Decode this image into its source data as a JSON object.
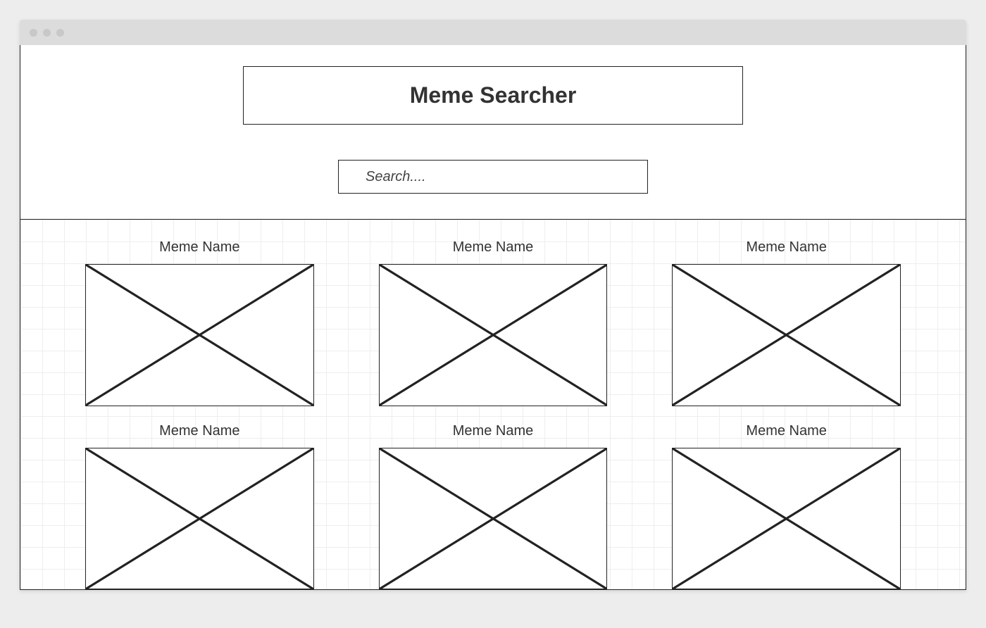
{
  "header": {
    "title": "Meme Searcher"
  },
  "search": {
    "placeholder": "Search....",
    "value": ""
  },
  "memes": [
    {
      "name": "Meme Name"
    },
    {
      "name": "Meme Name"
    },
    {
      "name": "Meme Name"
    },
    {
      "name": "Meme Name"
    },
    {
      "name": "Meme Name"
    },
    {
      "name": "Meme Name"
    }
  ]
}
